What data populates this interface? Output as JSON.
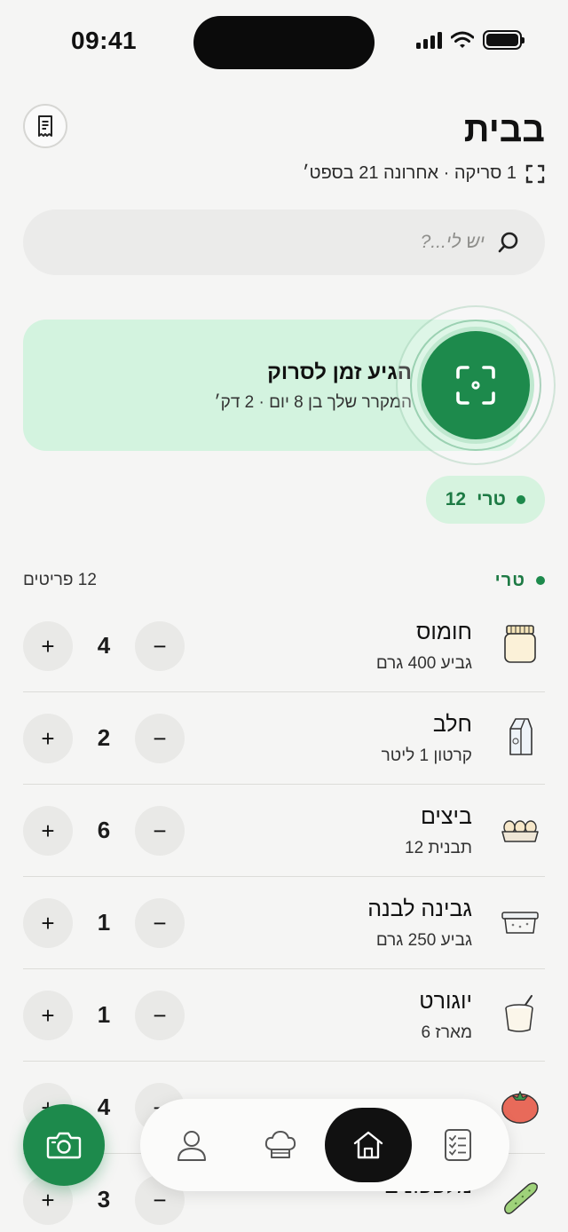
{
  "status_bar": {
    "time": "09:41"
  },
  "header": {
    "title": "בבית",
    "subtitle": "1 סריקה · אחרונה 21 בספט׳"
  },
  "search": {
    "placeholder": "יש לי...?"
  },
  "scan_card": {
    "title": "הגיע זמן לסרוק",
    "subtitle": "המקרר שלך בן 8 יום · 2 דק׳"
  },
  "fresh_chip": {
    "label": "טרי",
    "count": "12"
  },
  "section": {
    "title": "טרי",
    "count_label": "12 פריטים"
  },
  "items": [
    {
      "name": "חומוס",
      "desc": "גביע 400 גרם",
      "qty": "4",
      "icon": "jar-icon"
    },
    {
      "name": "חלב",
      "desc": "קרטון 1 ליטר",
      "qty": "2",
      "icon": "milk-carton-icon"
    },
    {
      "name": "ביצים",
      "desc": "תבנית 12",
      "qty": "6",
      "icon": "egg-carton-icon"
    },
    {
      "name": "גבינה לבנה",
      "desc": "גביע 250 גרם",
      "qty": "1",
      "icon": "cheese-tub-icon"
    },
    {
      "name": "יוגורט",
      "desc": "מארז 6",
      "qty": "1",
      "icon": "yogurt-cup-icon"
    },
    {
      "name": "",
      "desc": "",
      "qty": "4",
      "icon": "tomato-icon"
    },
    {
      "name": "מלפפונים",
      "desc": "",
      "qty": "3",
      "icon": "cucumber-icon"
    }
  ],
  "controls": {
    "plus": "+",
    "minus": "−"
  },
  "nav": {
    "items": [
      "profile-icon",
      "chef-hat-icon",
      "home-icon",
      "checklist-icon"
    ],
    "active": "home-icon"
  },
  "colors": {
    "accent": "#1d8a4c",
    "card_bg": "#d3f3df",
    "page_bg": "#f5f5f4"
  }
}
